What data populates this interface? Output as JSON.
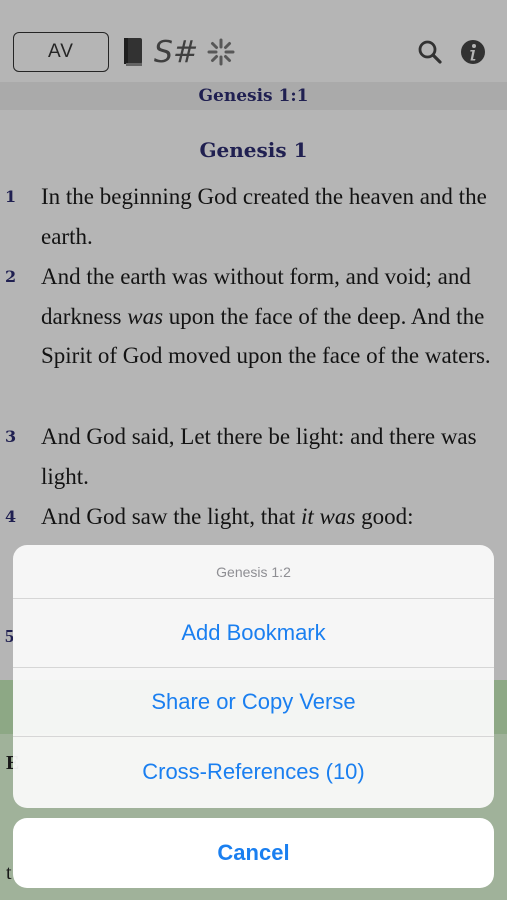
{
  "toolbar": {
    "version_label": "AV",
    "icons": [
      "book-icon",
      "strongs-icon",
      "asterisk-icon",
      "search-icon",
      "info-icon"
    ],
    "strongs_text": "S#",
    "asterisk_text": "*"
  },
  "reference_bar": {
    "text": "Genesis 1:1"
  },
  "chapter": {
    "title": "Genesis 1",
    "verses": [
      {
        "num": "1",
        "html": "In the beginning God created the heaven and the earth."
      },
      {
        "num": "2",
        "html": "And the earth was without form, and void; and darkness <i>was</i> upon the face of the deep. And the Spirit of God moved upon the face of the waters."
      },
      {
        "num": "3",
        "html": "And God said, Let there be light: and there was light."
      },
      {
        "num": "4",
        "html": "And God saw the light, that <i>it was</i> good:"
      }
    ],
    "partial_verse_num": "5",
    "partial_letter_b": "E",
    "partial_letter_t": "t"
  },
  "action_sheet": {
    "title": "Genesis 1:2",
    "buttons": [
      "Add Bookmark",
      "Share or Copy Verse",
      "Cross-References (10)"
    ],
    "cancel_label": "Cancel"
  },
  "colors": {
    "accent": "#1a7ff0",
    "verse_number": "#2c2c6e",
    "bottom_panel": "#d8f0d0"
  }
}
